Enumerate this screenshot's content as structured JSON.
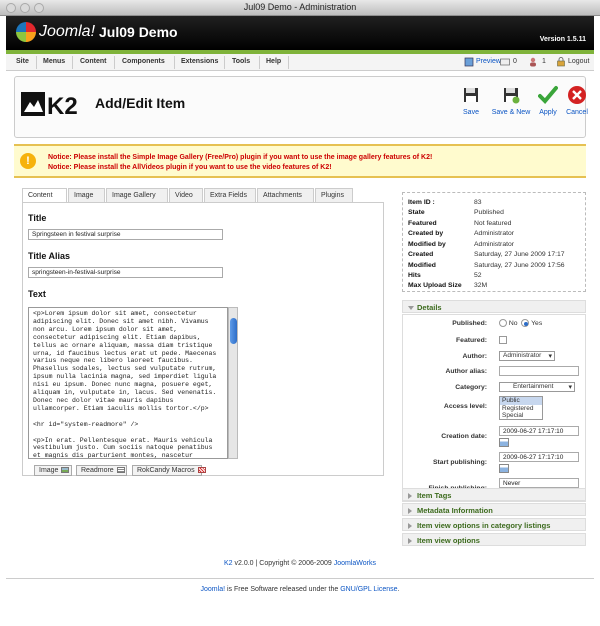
{
  "window": {
    "title": "Jul09 Demo - Administration"
  },
  "header": {
    "brand": "Joomla!",
    "site_name": "Jul09 Demo",
    "version": "Version 1.5.11"
  },
  "menu": {
    "items": [
      "Site",
      "Menus",
      "Content",
      "Components",
      "Extensions",
      "Tools",
      "Help"
    ],
    "preview": "Preview",
    "messages": "0",
    "users": "1",
    "logout": "Logout"
  },
  "toolbar": {
    "title": "Add/Edit Item",
    "buttons": [
      "Save",
      "Save & New",
      "Apply",
      "Cancel"
    ]
  },
  "notices": [
    "Notice: Please install the Simple Image Gallery (Free/Pro) plugin if you want to use the image gallery features of K2!",
    "Notice: Please install the AllVideos plugin if you want to use the video features of K2!"
  ],
  "tabs": [
    "Content",
    "Image",
    "Image Gallery",
    "Video",
    "Extra Fields",
    "Attachments",
    "Plugins"
  ],
  "content": {
    "title_label": "Title",
    "title_value": "Springsteen in festival surprise",
    "alias_label": "Title Alias",
    "alias_value": "springsteen-in-festival-surprise",
    "text_label": "Text",
    "text_value": "<p>Lorem ipsum dolor sit amet, consectetur adipiscing elit. Donec sit amet nibh. Vivamus non arcu. Lorem ipsum dolor sit amet, consectetur adipiscing elit. Etiam dapibus, tellus ac ornare aliquam, massa diam tristique urna, id faucibus lectus erat ut pede. Maecenas varius neque nec libero laoreet faucibus. Phasellus sodales, lectus sed vulputate rutrum, ipsum nulla lacinia magna, sed imperdiet ligula nisi eu ipsum. Donec nunc magna, posuere eget, aliquam in, vulputate in, lacus. Sed venenatis. Donec nec dolor vitae mauris dapibus ullamcorper. Etiam iaculis mollis tortor.</p>\n\n<hr id=\"system-readmore\" />\n\n<p>In erat. Pellentesque erat. Mauris vehicula vestibulum justo. Cum sociis natoque penatibus et magnis dis parturient montes, nascetur ridiculus mus. Nulla pulvinar est.",
    "editor_buttons": [
      "Image",
      "Readmore",
      "RokCandy Macros"
    ]
  },
  "info": [
    {
      "k": "Item ID :",
      "v": "83"
    },
    {
      "k": "State",
      "v": "Published"
    },
    {
      "k": "Featured",
      "v": "Not featured"
    },
    {
      "k": "Created by",
      "v": "Administrator"
    },
    {
      "k": "Modified by",
      "v": "Administrator"
    },
    {
      "k": "Created",
      "v": "Saturday, 27 June 2009 17:17"
    },
    {
      "k": "Modified",
      "v": "Saturday, 27 June 2009 17:56"
    },
    {
      "k": "Hits",
      "v": "52"
    },
    {
      "k": "Max Upload Size",
      "v": "32M"
    }
  ],
  "details": {
    "header": "Details",
    "published_label": "Published:",
    "no": "No",
    "yes": "Yes",
    "featured_label": "Featured:",
    "author_label": "Author:",
    "author_value": "Administrator",
    "author_alias_label": "Author alias:",
    "category_label": "Category:",
    "category_value": "Entertainment",
    "access_label": "Access level:",
    "access_options": [
      "Public",
      "Registered",
      "Special"
    ],
    "creation_label": "Creation date:",
    "creation_value": "2009-06-27 17:17:10",
    "start_label": "Start publishing:",
    "start_value": "2009-06-27 17:17:10",
    "finish_label": "Finish publishing:",
    "finish_value": "Never"
  },
  "accordion": [
    "Item Tags",
    "Metadata Information",
    "Item view options in category listings",
    "Item view options"
  ],
  "footer": {
    "k2": "K2",
    "k2_rest": " v2.0.0 | Copyright © 2006-2009 ",
    "works": "JoomlaWorks",
    "joomla": "Joomla!",
    "joomla_rest": " is Free Software released under the ",
    "license": "GNU/GPL License",
    "end": "."
  },
  "colors": {
    "accent": "#7fb33a",
    "link": "#0b55c4",
    "notice": "#c00"
  }
}
